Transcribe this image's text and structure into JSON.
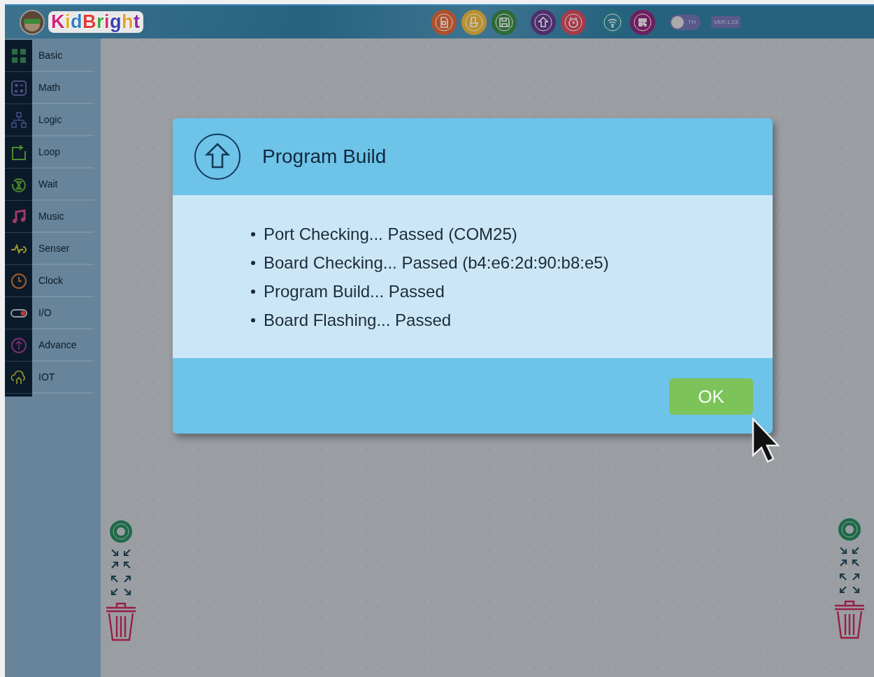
{
  "logo": {
    "text": "KidBright"
  },
  "toolbar": {
    "toggle": {
      "label": "TH",
      "on": false
    },
    "version": "VER.1.23"
  },
  "sidebar": {
    "items": [
      {
        "label": "Basic",
        "kind": "grid"
      },
      {
        "label": "Math",
        "kind": "calc"
      },
      {
        "label": "Logic",
        "kind": "tree"
      },
      {
        "label": "Loop",
        "kind": "loop"
      },
      {
        "label": "Wait",
        "kind": "wait"
      },
      {
        "label": "Music",
        "kind": "music"
      },
      {
        "label": "Senser",
        "kind": "sensor"
      },
      {
        "label": "Clock",
        "kind": "clock"
      },
      {
        "label": "I/O",
        "kind": "io"
      },
      {
        "label": "Advance",
        "kind": "advance"
      },
      {
        "label": "IOT",
        "kind": "iot"
      }
    ]
  },
  "dialog": {
    "title": "Program Build",
    "lines": [
      "Port Checking... Passed (COM25)",
      "Board Checking... Passed (b4:e6:2d:90:b8:e5)",
      "Program Build... Passed",
      "Board Flashing... Passed"
    ],
    "button": "OK"
  }
}
